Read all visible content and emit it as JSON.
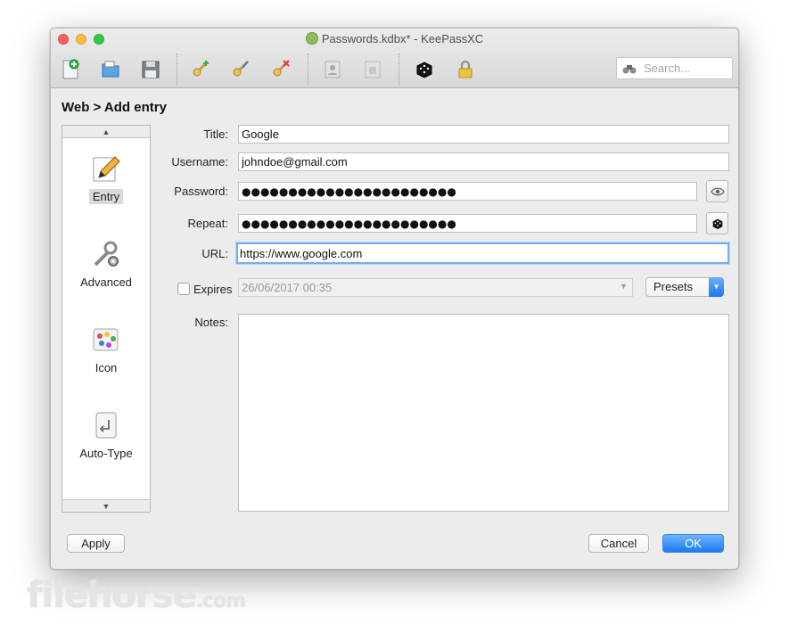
{
  "window": {
    "title": "Passwords.kdbx* - KeePassXC"
  },
  "toolbar": {
    "icons": [
      "new-database-icon",
      "open-database-icon",
      "save-database-icon",
      "add-entry-icon",
      "edit-entry-icon",
      "delete-entry-icon",
      "copy-username-icon",
      "copy-password-icon",
      "password-generator-icon",
      "lock-database-icon"
    ],
    "search_placeholder": "Search..."
  },
  "breadcrumb": "Web > Add entry",
  "sidebar": {
    "items": [
      {
        "label": "Entry",
        "icon": "pencil-icon",
        "selected": true
      },
      {
        "label": "Advanced",
        "icon": "wrench-gear-icon",
        "selected": false
      },
      {
        "label": "Icon",
        "icon": "palette-icon",
        "selected": false
      },
      {
        "label": "Auto-Type",
        "icon": "keyboard-key-icon",
        "selected": false
      }
    ]
  },
  "form": {
    "title_label": "Title:",
    "title_value": "Google",
    "username_label": "Username:",
    "username_value": "johndoe@gmail.com",
    "password_label": "Password:",
    "password_value": "●●●●●●●●●●●●●●●●●●●●●●●",
    "repeat_label": "Repeat:",
    "repeat_value": "●●●●●●●●●●●●●●●●●●●●●●●",
    "url_label": "URL:",
    "url_value": "https://www.google.com",
    "expires_label": "Expires",
    "expires_value": "26/06/2017 00:35",
    "presets_label": "Presets",
    "notes_label": "Notes:",
    "notes_value": ""
  },
  "buttons": {
    "apply": "Apply",
    "cancel": "Cancel",
    "ok": "OK"
  },
  "watermark": {
    "main": "filehorse",
    "suffix": ".com"
  },
  "colors": {
    "accent": "#1c7cf3",
    "focus_ring": "#7aacf5"
  }
}
